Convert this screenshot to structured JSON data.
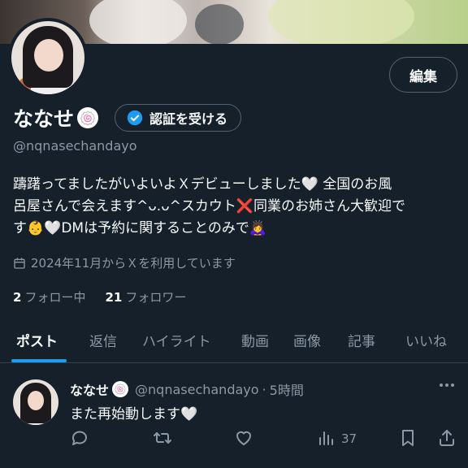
{
  "profile": {
    "edit_label": "編集",
    "display_name": "ななせ",
    "name_emoji": "🍥",
    "verify_label": "認証を受ける",
    "handle": "@nqnasechandayo",
    "bio_lines": [
      "躊躇ってましたがいよいよＸデビューしました🤍 全国のお風",
      "呂屋さんで会えます^ᴗ.ᴗ^スカウト❌同業のお姉さん大歓迎で",
      "す👶🤍DMは予約に関することのみで🙇‍♀️"
    ],
    "joined": "2024年11月からＸを利用しています",
    "following_count": "2",
    "following_label": "フォロー中",
    "followers_count": "21",
    "followers_label": "フォロワー"
  },
  "tabs": [
    "ポスト",
    "返信",
    "ハイライト",
    "動画",
    "画像",
    "記事",
    "いいね"
  ],
  "post": {
    "name": "ななせ",
    "name_emoji": "🍥",
    "handle": "@nqnasechandayo",
    "dot": "·",
    "time": "5時間",
    "text": "また再始動します🤍",
    "views": "37"
  },
  "colors": {
    "background": "#15202b",
    "accent": "#1d9bf0",
    "muted": "#8b98a5"
  }
}
